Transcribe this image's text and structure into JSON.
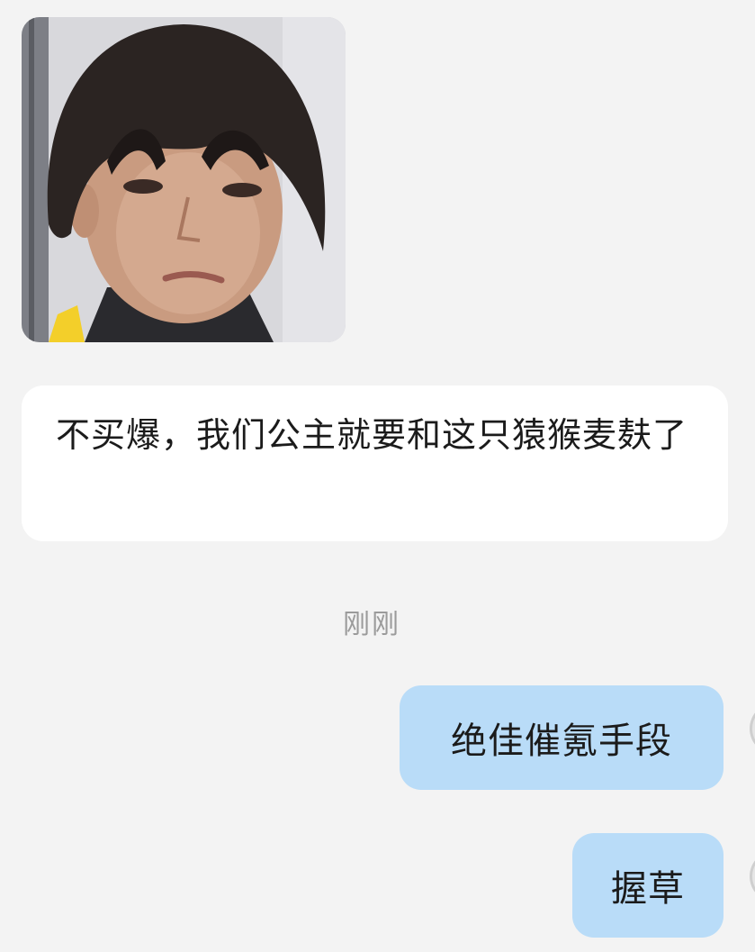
{
  "messages": [
    {
      "type": "image",
      "direction": "incoming",
      "alt_icon": "selfie-photo"
    },
    {
      "type": "text",
      "direction": "incoming",
      "text": "不买爆，我们公主就要和这只猿猴麦麸了"
    }
  ],
  "time_divider": "刚刚",
  "outgoing": [
    {
      "text": "绝佳催氪手段"
    },
    {
      "text": "握草"
    }
  ],
  "colors": {
    "background": "#f3f3f3",
    "incoming_bubble": "#ffffff",
    "outgoing_bubble": "#b9dcf8",
    "timestamp": "#9b9b9b"
  }
}
